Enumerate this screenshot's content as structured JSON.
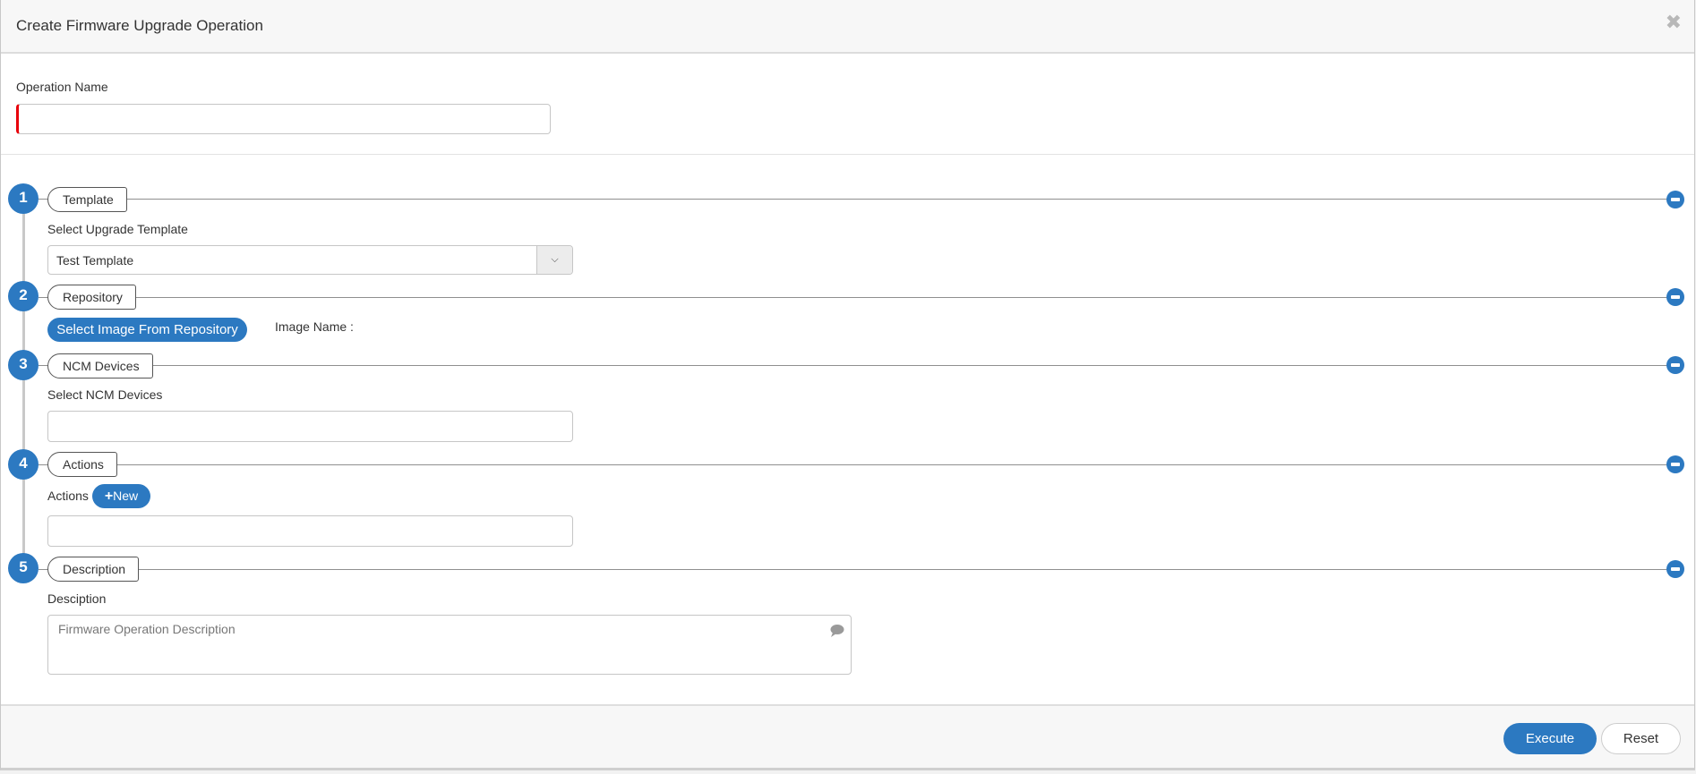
{
  "dialog": {
    "title": "Create Firmware Upgrade Operation",
    "close_icon": "close-icon"
  },
  "operation_name": {
    "label": "Operation Name",
    "value": "",
    "required": true
  },
  "steps": [
    {
      "number": "1",
      "tab": "Template",
      "collapse_icon": "minus-circle-icon"
    },
    {
      "number": "2",
      "tab": "Repository",
      "collapse_icon": "minus-circle-icon"
    },
    {
      "number": "3",
      "tab": "NCM Devices",
      "collapse_icon": "minus-circle-icon"
    },
    {
      "number": "4",
      "tab": "Actions",
      "collapse_icon": "minus-circle-icon"
    },
    {
      "number": "5",
      "tab": "Description",
      "collapse_icon": "minus-circle-icon"
    }
  ],
  "template": {
    "label": "Select Upgrade Template",
    "selected": "Test Template",
    "arrow_icon": "chevron-down-icon"
  },
  "repository": {
    "button": "Select Image From Repository",
    "image_name_label": "Image Name :"
  },
  "ncm_devices": {
    "label": "Select NCM Devices",
    "value": ""
  },
  "actions": {
    "label": "Actions",
    "new_button": "New",
    "new_icon": "plus-icon",
    "value": ""
  },
  "description": {
    "label": "Desciption",
    "placeholder": "Firmware Operation Description",
    "value": "",
    "icon": "comment-icon"
  },
  "footer": {
    "execute": "Execute",
    "reset": "Reset"
  },
  "colors": {
    "accent": "#2c79c1",
    "required_marker": "#e8000b"
  }
}
